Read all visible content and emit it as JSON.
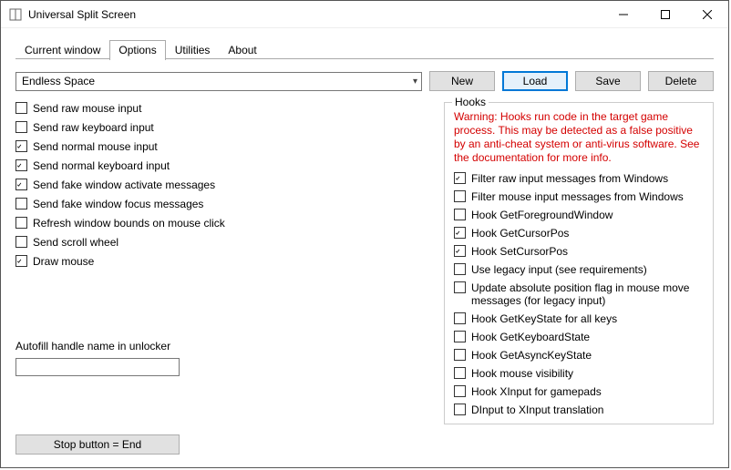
{
  "window": {
    "title": "Universal Split Screen"
  },
  "tabs": [
    {
      "label": "Current window",
      "active": false
    },
    {
      "label": "Options",
      "active": true
    },
    {
      "label": "Utilities",
      "active": false
    },
    {
      "label": "About",
      "active": false
    }
  ],
  "preset": {
    "selected": "Endless Space"
  },
  "buttons": {
    "new": "New",
    "load": "Load",
    "save": "Save",
    "delete": "Delete"
  },
  "left_options": [
    {
      "label": "Send raw mouse input",
      "checked": false
    },
    {
      "label": "Send raw keyboard input",
      "checked": false
    },
    {
      "label": "Send normal mouse input",
      "checked": true
    },
    {
      "label": "Send normal keyboard input",
      "checked": true
    },
    {
      "label": "Send fake window activate messages",
      "checked": true
    },
    {
      "label": "Send fake window focus messages",
      "checked": false
    },
    {
      "label": "Refresh window bounds on mouse click",
      "checked": false
    },
    {
      "label": "Send scroll wheel",
      "checked": false
    },
    {
      "label": "Draw mouse",
      "checked": true
    }
  ],
  "autofill_label": "Autofill handle name in unlocker",
  "autofill_value": "",
  "stop_button_label": "Stop button = End",
  "hooks": {
    "group_label": "Hooks",
    "warning": "Warning: Hooks run code in the target game process. This may be detected as a false positive by an anti-cheat system or anti-virus software. See the documentation for more info.",
    "items": [
      {
        "label": "Filter raw input messages from Windows",
        "checked": true
      },
      {
        "label": "Filter mouse input messages from Windows",
        "checked": false
      },
      {
        "label": "Hook GetForegroundWindow",
        "checked": false
      },
      {
        "label": "Hook GetCursorPos",
        "checked": true
      },
      {
        "label": "Hook SetCursorPos",
        "checked": true
      },
      {
        "label": "Use legacy input (see requirements)",
        "checked": false
      },
      {
        "label": "Update absolute position flag in mouse move messages (for legacy input)",
        "checked": false
      },
      {
        "label": "Hook GetKeyState for all keys",
        "checked": false
      },
      {
        "label": "Hook GetKeyboardState",
        "checked": false
      },
      {
        "label": "Hook GetAsyncKeyState",
        "checked": false
      },
      {
        "label": "Hook mouse visibility",
        "checked": false
      },
      {
        "label": "Hook XInput for gamepads",
        "checked": false
      },
      {
        "label": "DInput to XInput translation",
        "checked": false
      }
    ]
  }
}
